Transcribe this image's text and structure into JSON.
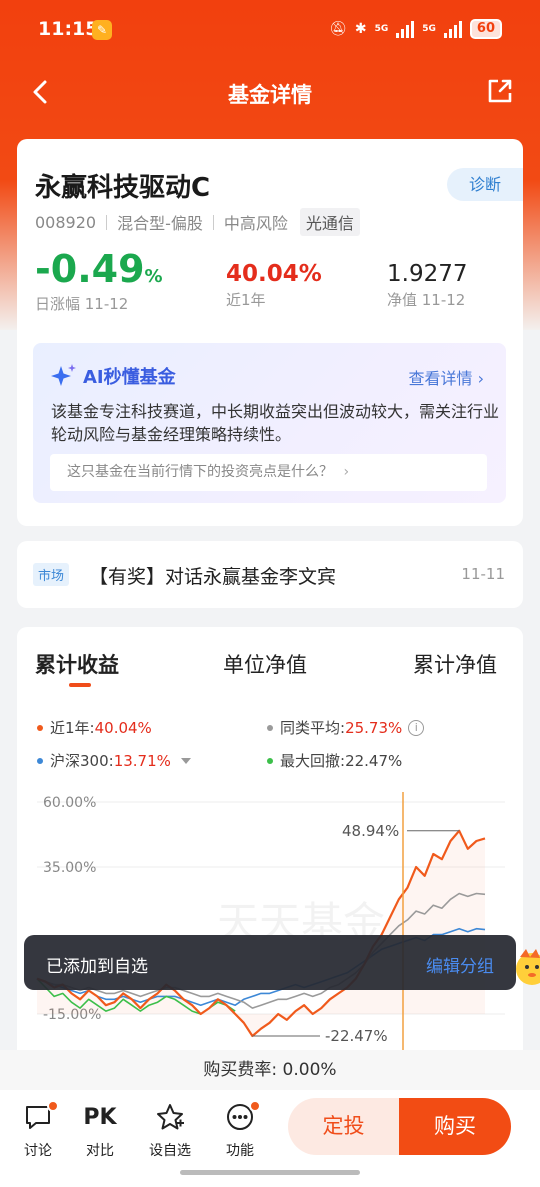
{
  "status_bar": {
    "time": "11:15",
    "net1": "5G",
    "net2": "5G",
    "battery": "60"
  },
  "nav": {
    "title": "基金详情"
  },
  "fund": {
    "name": "永赢科技驱动C",
    "diagnose": "诊断",
    "code": "008920",
    "type": "混合型-偏股",
    "risk": "中高风险",
    "tag": "光通信",
    "daily_change": "-0.49",
    "daily_change_unit": "%",
    "daily_label": "日涨幅 11-12",
    "year_return": "40.04%",
    "year_label": "近1年",
    "nav_value": "1.9277",
    "nav_label": "净值 11-12"
  },
  "ai": {
    "title": "AI秒懂基金",
    "more": "查看详情",
    "summary": "该基金专注科技赛道，中长期收益突出但波动较大，需关注行业轮动风险与基金经理策略持续性。",
    "question": "这只基金在当前行情下的投资亮点是什么？"
  },
  "news": {
    "tag": "市场",
    "text": "【有奖】对话永赢基金李文宾",
    "date": "11-11"
  },
  "tabs": [
    "累计收益",
    "单位净值",
    "累计净值"
  ],
  "legend": {
    "fund_label": "近1年:",
    "fund_value": "40.04%",
    "peer_label": "同类平均:",
    "peer_value": "25.73%",
    "index_label": "沪深300:",
    "index_value": "13.71%",
    "drawdown_label": "最大回撤:",
    "drawdown_value": "22.47%"
  },
  "chart_data": {
    "type": "line",
    "y_ticks": [
      "60.00%",
      "35.00%",
      "-15.00%"
    ],
    "ylim": [
      -30,
      60
    ],
    "max_annotation": "48.94%",
    "min_annotation": "-22.47%",
    "watermark": "天天基金",
    "series": [
      {
        "name": "近1年",
        "color": "#f05a1c",
        "values": [
          -3,
          -4,
          -6,
          -5,
          -8,
          -10,
          -7,
          -9,
          -12,
          -11,
          -8,
          -10,
          -13,
          -10,
          -8,
          -5,
          -7,
          -10,
          -12,
          -15,
          -13,
          -10,
          -12,
          -15,
          -18,
          -22.47,
          -20,
          -18,
          -15,
          -17,
          -14,
          -12,
          -15,
          -13,
          -10,
          -8,
          -6,
          -3,
          2,
          8,
          12,
          18,
          24,
          28,
          35,
          32,
          40,
          38,
          45,
          48.94,
          42,
          45,
          46
        ]
      },
      {
        "name": "同类平均",
        "color": "#9a9a9a",
        "values": [
          -3,
          -4,
          -5,
          -5,
          -6,
          -7,
          -6,
          -7,
          -8,
          -8,
          -7,
          -8,
          -9,
          -8,
          -7,
          -6,
          -6,
          -7,
          -8,
          -9,
          -9,
          -8,
          -9,
          -10,
          -11,
          -13,
          -12,
          -11,
          -10,
          -10,
          -9,
          -8,
          -9,
          -8,
          -6,
          -5,
          -3,
          -1,
          2,
          6,
          9,
          12,
          15,
          17,
          20,
          19,
          22,
          21,
          24,
          26,
          25,
          26,
          25.73
        ]
      },
      {
        "name": "沪深300",
        "color": "#3d88d6",
        "values": [
          -3,
          -4,
          -5,
          -6,
          -7,
          -8,
          -7,
          -9,
          -10,
          -10,
          -9,
          -10,
          -11,
          -10,
          -9,
          -9,
          -9,
          -10,
          -11,
          -12,
          -11,
          -10,
          -11,
          -12,
          -10,
          -9,
          -8,
          -8,
          -7,
          -6,
          -5,
          -6,
          -5,
          -4,
          -3,
          -2,
          -1,
          1,
          3,
          5,
          7,
          8,
          9,
          10,
          11,
          10,
          12,
          12,
          13,
          14,
          13,
          14,
          13.71
        ]
      },
      {
        "name": "最大回撤",
        "color": "#3cbf4a",
        "values": [
          -3,
          -6,
          -9,
          -8,
          -11,
          -13,
          -10,
          -12,
          -14,
          -13,
          -10,
          -12,
          -14,
          -12,
          -11,
          -9,
          -10,
          -12,
          -14,
          -15,
          -13,
          -11,
          -12,
          -14
        ]
      }
    ]
  },
  "toast": {
    "text": "已添加到自选",
    "action": "编辑分组"
  },
  "fee": {
    "text": "购买费率: 0.00%"
  },
  "bottom": {
    "discuss": "讨论",
    "pk": "PK",
    "compare": "对比",
    "watch": "设自选",
    "func": "功能",
    "fixed": "定投",
    "buy": "购买"
  }
}
